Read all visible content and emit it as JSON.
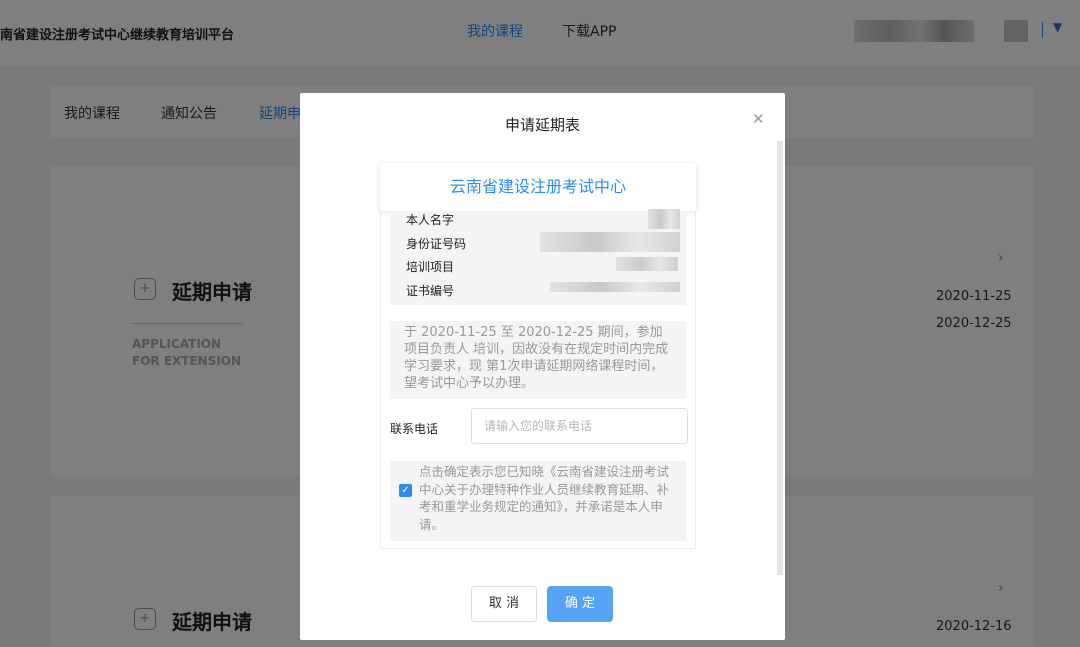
{
  "header": {
    "site_title": "南省建设注册考试中心继续教育培训平台",
    "nav": [
      {
        "label": "我的课程",
        "active": true
      },
      {
        "label": "下载APP",
        "active": false
      }
    ],
    "user_menu_icon": "caret-down-icon"
  },
  "tabs": [
    {
      "label": "我的课程"
    },
    {
      "label": "通知公告"
    },
    {
      "label": "延期申"
    }
  ],
  "cards": [
    {
      "icon": "+",
      "title": "延期申请",
      "subtitle_en_1": "APPLICATION",
      "subtitle_en_2": "FOR EXTENSION",
      "dates": [
        "2020-11-25",
        "2020-12-25"
      ]
    },
    {
      "icon": "+",
      "title": "延期申请",
      "dates": [
        "2020-12-16"
      ]
    }
  ],
  "modal": {
    "title": "申请延期表",
    "close_icon": "close-icon",
    "org_name": "云南省建设注册考试中心",
    "info": {
      "name_label": "本人名字",
      "id_label": "身份证号码",
      "project_label": "培训项目",
      "cert_label": "证书编号"
    },
    "description": "于 2020-11-25 至 2020-12-25 期间，参加 项目负责人 培训，因故没有在规定时间内完成学习要求，现 第1次申请延期网络课程时间，望考试中心予以办理。",
    "phone": {
      "label": "联系电话",
      "placeholder": "请输入您的联系电话",
      "value": ""
    },
    "agreement": {
      "checked": true,
      "text": "点击确定表示您已知晓《云南省建设注册考试中心关于办理特种作业人员继续教育延期、补考和重学业务规定的通知》，并承诺是本人申请。"
    },
    "cancel_label": "取 消",
    "ok_label": "确 定",
    "accent_color": "#2d8cf0"
  }
}
